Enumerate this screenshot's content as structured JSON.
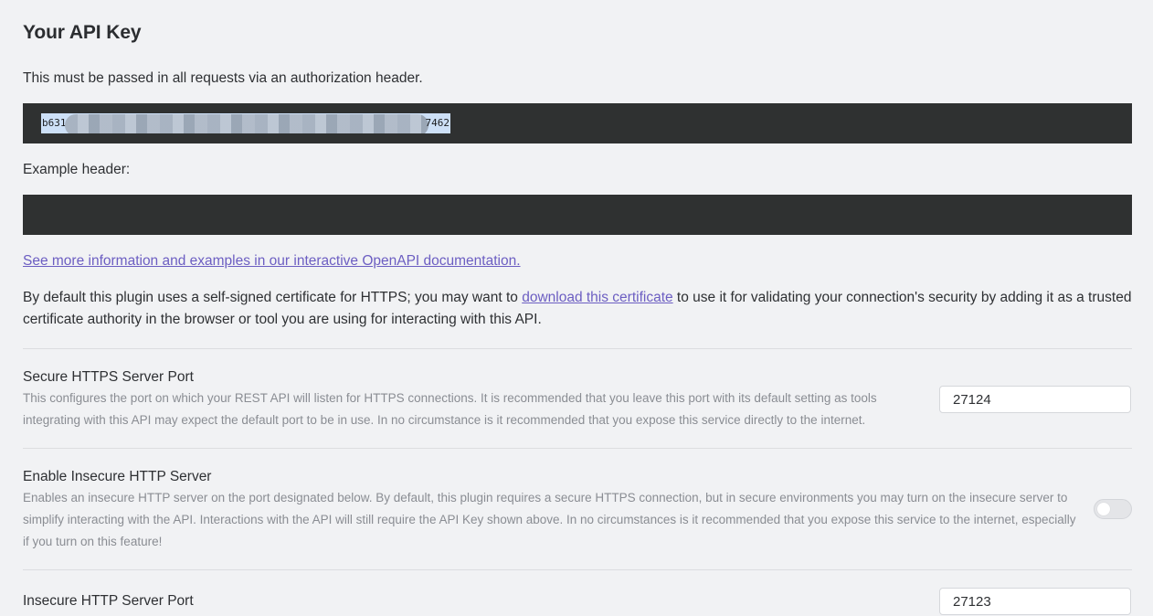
{
  "section": {
    "title": "Your API Key",
    "auth_note": "This must be passed in all requests via an authorization header.",
    "api_key": {
      "prefix": "b631",
      "suffix": "7462"
    },
    "example_header_label": "Example header:",
    "doc_link": "See more information and examples in our interactive OpenAPI documentation.",
    "cert_note": {
      "before": "By default this plugin uses a self-signed certificate for HTTPS; you may want to ",
      "link": "download this certificate",
      "after": " to use it for validating your connection's security by adding it as a trusted certificate authority in the browser or tool you are using for interacting with this API."
    }
  },
  "settings": {
    "https_port": {
      "name": "Secure HTTPS Server Port",
      "desc": "This configures the port on which your REST API will listen for HTTPS connections. It is recommended that you leave this port with its default setting as tools integrating with this API may expect the default port to be in use. In no circumstance is it recommended that you expose this service directly to the internet.",
      "value": "27124"
    },
    "insecure_http": {
      "name": "Enable Insecure HTTP Server",
      "desc": "Enables an insecure HTTP server on the port designated below. By default, this plugin requires a secure HTTPS connection, but in secure environments you may turn on the insecure server to simplify interacting with the API. Interactions with the API will still require the API Key shown above. In no circumstances is it recommended that you expose this service to the internet, especially if you turn on this feature!",
      "enabled": false
    },
    "http_port": {
      "name": "Insecure HTTP Server Port",
      "value": "27123"
    }
  },
  "colors": {
    "background": "#f1f2f4",
    "code_block": "#2f3131",
    "link": "#6c5ec2",
    "muted_text": "#8a8d93",
    "selection": "#cde0f7"
  }
}
